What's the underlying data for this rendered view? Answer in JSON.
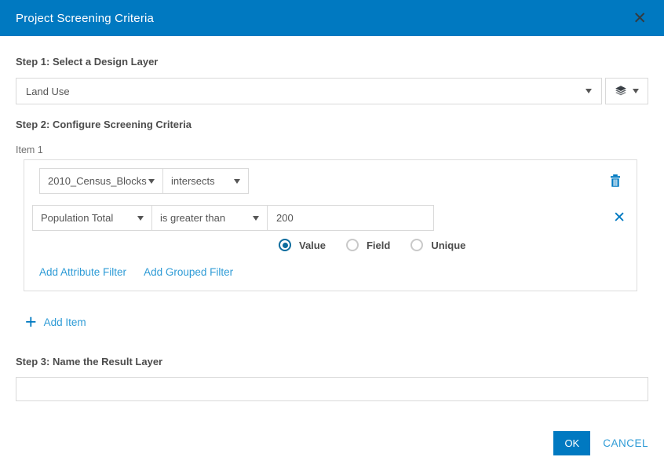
{
  "dialog": {
    "title": "Project Screening Criteria",
    "colors": {
      "header_bg": "#0079c1",
      "primary_blue": "#0079c1",
      "link_blue": "#2e9bd6",
      "radio_selected": "#0c6d9e",
      "text_dark": "#4c4c4c",
      "border": "#d9d9d9"
    }
  },
  "step1": {
    "label": "Step 1: Select a Design Layer",
    "layer_select": {
      "value": "Land Use"
    },
    "layer_button_icon": "layers-icon"
  },
  "step2": {
    "label": "Step 2: Configure Screening Criteria",
    "item_label": "Item 1",
    "item": {
      "spatial_filter": {
        "layer": "2010_Census_Blocks",
        "operator": "intersects"
      },
      "attribute_filter": {
        "field": "Population Total",
        "operator": "is greater than",
        "value": "200"
      },
      "value_type_options": [
        {
          "label": "Value",
          "selected": true
        },
        {
          "label": "Field",
          "selected": false
        },
        {
          "label": "Unique",
          "selected": false
        }
      ],
      "links": {
        "add_attribute_filter": "Add Attribute Filter",
        "add_grouped_filter": "Add Grouped Filter"
      }
    },
    "add_item_label": "Add Item"
  },
  "step3": {
    "label": "Step 3: Name the Result Layer",
    "input_value": "",
    "input_placeholder": ""
  },
  "footer": {
    "ok_label": "OK",
    "cancel_label": "CANCEL"
  }
}
